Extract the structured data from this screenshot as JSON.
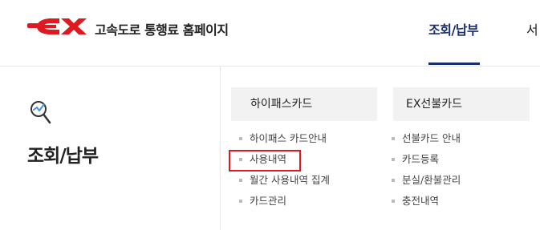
{
  "header": {
    "site_title": "고속도로 통행료 홈페이지",
    "nav_active": "조회/납부",
    "nav_next": "서",
    "brand_color": "#e0181f",
    "nav_color": "#1a2f6b"
  },
  "sidebar": {
    "icon": "search-icon",
    "title": "조회/납부"
  },
  "columns": [
    {
      "heading": "하이패스카드",
      "items": [
        "하이패스 카드안내",
        "사용내역",
        "월간 사용내역 집계",
        "카드관리"
      ]
    },
    {
      "heading": "EX선불카드",
      "items": [
        "선불카드 안내",
        "카드등록",
        "분실/환불관리",
        "충전내역"
      ]
    }
  ],
  "highlight": {
    "target": "사용내역",
    "color": "#e0181f"
  }
}
